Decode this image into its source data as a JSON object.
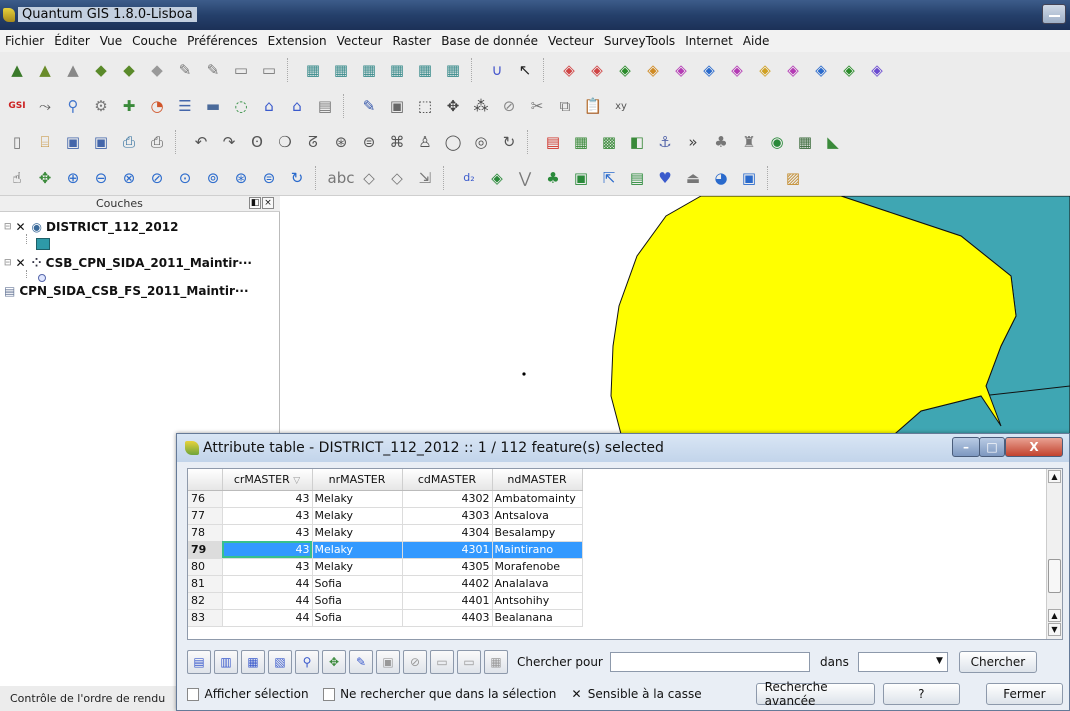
{
  "window": {
    "title": "Quantum GIS 1.8.0-Lisboa"
  },
  "menu": [
    "Fichier",
    "Éditer",
    "Vue",
    "Couche",
    "Préférences",
    "Extension",
    "Vecteur",
    "Raster",
    "Base de donnée",
    "Vecteur",
    "SurveyTools",
    "Internet",
    "Aide"
  ],
  "layers_panel": {
    "title": "Couches",
    "layers": [
      {
        "name": "DISTRICT_112_2012",
        "checked": true
      },
      {
        "name": "CSB_CPN_SIDA_2011_Maintir···",
        "checked": true
      },
      {
        "name": "CPN_SIDA_CSB_FS_2011_Maintir···",
        "checked": false
      }
    ]
  },
  "status": {
    "text": "Contrôle de l'ordre de rendu"
  },
  "attribute_table": {
    "title": "Attribute table - DISTRICT_112_2012 :: 1 / 112 feature(s) selected",
    "columns": [
      "crMASTER",
      "nrMASTER",
      "cdMASTER",
      "ndMASTER"
    ],
    "rows": [
      {
        "n": "76",
        "cr": "43",
        "nr": "Melaky",
        "cd": "4302",
        "nd": "Ambatomainty"
      },
      {
        "n": "77",
        "cr": "43",
        "nr": "Melaky",
        "cd": "4303",
        "nd": "Antsalova"
      },
      {
        "n": "78",
        "cr": "43",
        "nr": "Melaky",
        "cd": "4304",
        "nd": "Besalampy"
      },
      {
        "n": "79",
        "cr": "43",
        "nr": "Melaky",
        "cd": "4301",
        "nd": "Maintirano"
      },
      {
        "n": "80",
        "cr": "43",
        "nr": "Melaky",
        "cd": "4305",
        "nd": "Morafenobe"
      },
      {
        "n": "81",
        "cr": "44",
        "nr": "Sofia",
        "cd": "4402",
        "nd": "Analalava"
      },
      {
        "n": "82",
        "cr": "44",
        "nr": "Sofia",
        "cd": "4401",
        "nd": "Antsohihy"
      },
      {
        "n": "83",
        "cr": "44",
        "nr": "Sofia",
        "cd": "4403",
        "nd": "Bealanana"
      }
    ],
    "selected_row": "79",
    "search_label": "Chercher pour",
    "search_value": "",
    "in_label": "dans",
    "field_value": "",
    "search_button": "Chercher",
    "show_selection_label": "Afficher sélection",
    "search_in_selection_label": "Ne rechercher que dans la sélection",
    "case_sensitive_label": "Sensible à la casse",
    "advanced_search_button": "Recherche avancée",
    "help_button": "?",
    "close_button": "Fermer"
  },
  "colors": {
    "land_yellow": "#ffff00",
    "sea_teal": "#3fa6b3",
    "selection": "#3399ff"
  }
}
